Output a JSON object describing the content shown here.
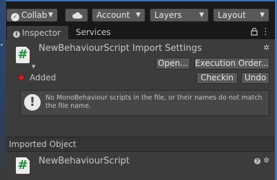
{
  "toolbar": {
    "collab_label": "Collab",
    "account_label": "Account",
    "layers_label": "Layers",
    "layout_label": "Layout",
    "cloud_icon": "cloud-icon"
  },
  "tabs": {
    "inspector_label": "Inspector",
    "services_label": "Services"
  },
  "header": {
    "title": "NewBehaviourScript Import Settings",
    "script_glyph": "#",
    "open_label": "Open...",
    "execution_order_label": "Execution Order...",
    "checkin_label": "Checkin",
    "undo_label": "Undo",
    "status_label": "Added",
    "help_message": "No MonoBehaviour scripts in the file, or their names do not match the file name."
  },
  "imported": {
    "section_label": "Imported Object",
    "object_name": "NewBehaviourScript",
    "script_glyph": "#"
  },
  "colors": {
    "accent_blue": "#3b73c5",
    "panel_bg": "#3c3c3c",
    "button_bg": "#585858",
    "script_green": "#1d8a39",
    "status_red": "#c52a2a"
  }
}
